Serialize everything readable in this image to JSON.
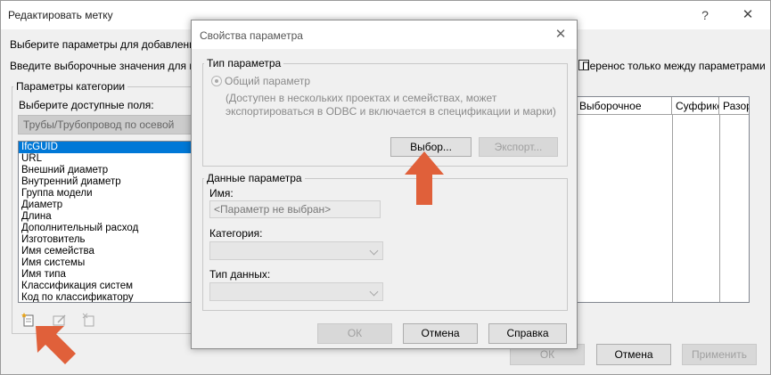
{
  "main_dialog": {
    "title": "Редактировать метку",
    "help_glyph": "?",
    "close_glyph": "✕",
    "instruction_line1": "Выберите параметры для добавления в",
    "instruction_line2": "Введите выборочные значения для пре",
    "transfer_checkbox_label": "Перенос только между параметрами",
    "transfer_checked": false,
    "category_group_label": "Параметры категории",
    "available_fields_label": "Выберите доступные поля:",
    "category_value": "Трубы/Трубопровод по осевой",
    "fields": [
      "IfcGUID",
      "URL",
      "Внешний диаметр",
      "Внутренний диаметр",
      "Группа модели",
      "Диаметр",
      "Длина",
      "Дополнительный расход",
      "Изготовитель",
      "Имя семейства",
      "Имя системы",
      "Имя типа",
      "Классификация систем",
      "Код по классификатору"
    ],
    "selected_field": "IfcGUID",
    "tool_icons": [
      "add-parameter-icon",
      "edit-parameter-icon",
      "delete-parameter-icon"
    ],
    "table_columns": [
      "Выборочное",
      "Суффикс",
      "Разор"
    ],
    "buttons": {
      "ok": "ОК",
      "cancel": "Отмена",
      "apply": "Применить"
    }
  },
  "child_dialog": {
    "title": "Свойства параметра",
    "close_glyph": "✕",
    "type_group_label": "Тип параметра",
    "radio_label": "Общий параметр",
    "description": "(Доступен в нескольких проектах и семействах, может экспортироваться в ODBC и включается в спецификации и марки)",
    "select_button": "Выбор...",
    "export_button": "Экспорт...",
    "data_group_label": "Данные параметра",
    "name_label": "Имя:",
    "name_value": "<Параметр не выбран>",
    "category_label": "Категория:",
    "data_type_label": "Тип данных:",
    "buttons": {
      "ok": "ОК",
      "cancel": "Отмена",
      "help": "Справка"
    }
  },
  "colors": {
    "annotation_arrow": "#e0603a",
    "selection": "#0078d7",
    "dialog_background": "#f0f0f0"
  }
}
